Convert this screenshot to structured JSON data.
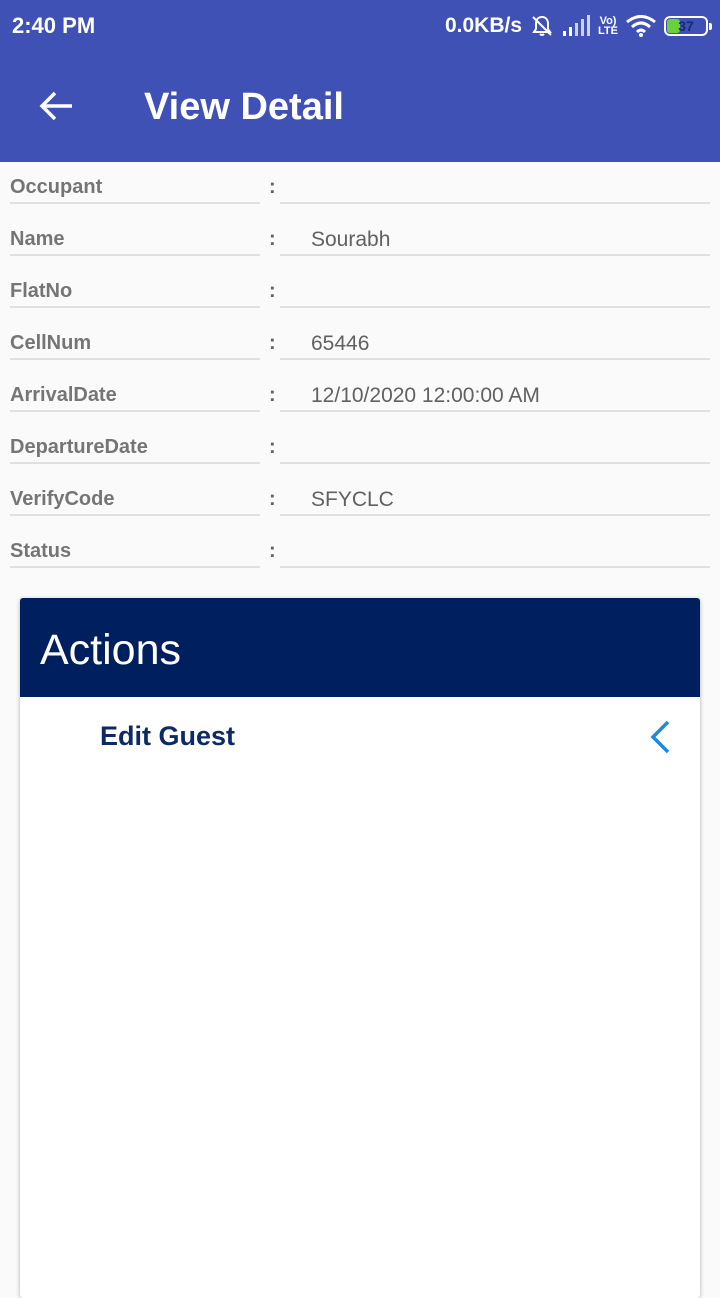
{
  "status_bar": {
    "time": "2:40 PM",
    "net_speed": "0.0KB/s",
    "lte_top": "Vo)",
    "lte_bottom": "LTE",
    "battery_level": "37",
    "battery_color": "#6bd13a"
  },
  "app_bar": {
    "title": "View Detail",
    "back_icon": "arrow-left-icon",
    "color": "#3f51b5"
  },
  "details": [
    {
      "label": "Occupant",
      "colon": ":",
      "value": ""
    },
    {
      "label": "Name",
      "colon": ":",
      "value": "Sourabh"
    },
    {
      "label": "FlatNo",
      "colon": ":",
      "value": ""
    },
    {
      "label": "CellNum",
      "colon": ":",
      "value": "65446"
    },
    {
      "label": "ArrivalDate",
      "colon": ":",
      "value": "12/10/2020 12:00:00 AM"
    },
    {
      "label": "DepartureDate",
      "colon": ":",
      "value": ""
    },
    {
      "label": "VerifyCode",
      "colon": ":",
      "value": "SFYCLC"
    },
    {
      "label": "Status",
      "colon": ":",
      "value": ""
    }
  ],
  "actions": {
    "title": "Actions",
    "header_color": "#001f5f",
    "items": [
      {
        "label": "Edit Guest",
        "icon": "chevron-left-icon"
      }
    ]
  }
}
